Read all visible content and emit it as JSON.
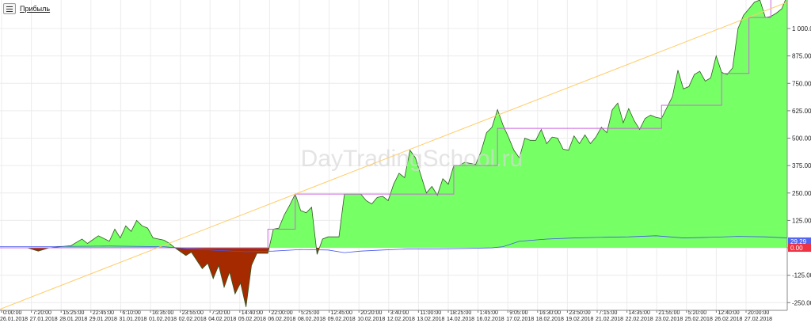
{
  "legend": {
    "label": "Прибыль"
  },
  "watermark": "DayTradingSchool.ru",
  "colors": {
    "profit": "#77ff66",
    "loss": "#a52a00",
    "line_purple": "#cc66dd",
    "line_blue": "#4455ee",
    "trend": "#ffcc66",
    "grid": "#ececec"
  },
  "chart_data": {
    "type": "area",
    "title": "",
    "y_ticks": [
      "1 000.00",
      "875.00",
      "750.00",
      "625.00",
      "500.00",
      "375.00",
      "250.00",
      "125.00",
      "0.00",
      "-125.00",
      "-250.00"
    ],
    "y_tick_values": [
      1000,
      875,
      750,
      625,
      500,
      375,
      250,
      125,
      0,
      -125,
      -250
    ],
    "ylim": [
      -285,
      1130
    ],
    "x_tick_times": [
      "0:00:00",
      "7:20:00",
      "15:25:00",
      "22:45:00",
      "6:10:00",
      "16:35:00",
      "23:55:00",
      "7:20:00",
      "14:40:00",
      "22:00:00",
      "5:25:00",
      "12:45:00",
      "20:20:00",
      "3:40:00",
      "11:00:00",
      "18:25:00",
      "1:45:00",
      "9:05:00",
      "16:30:00",
      "23:50:00",
      "7:15:00",
      "14:35:00",
      "21:55:00",
      "5:20:00",
      "12:40:00",
      "20:00:00"
    ],
    "x_tick_dates": [
      "26.01.2018",
      "27.01.2018",
      "28.01.2018",
      "29.01.2018",
      "31.01.2018",
      "01.02.2018",
      "02.02.2018",
      "04.02.2018",
      "05.02.2018",
      "06.02.2018",
      "08.02.2018",
      "09.02.2018",
      "10.02.2018",
      "12.02.2018",
      "13.02.2018",
      "14.02.2018",
      "16.02.2018",
      "17.02.2018",
      "18.02.2018",
      "19.02.2018",
      "21.02.2018",
      "22.02.2018",
      "23.02.2018",
      "25.02.2018",
      "26.02.2018",
      "27.02.2018"
    ],
    "value_labels": [
      {
        "text": "29.29",
        "value": 29.29,
        "color": "#5566ee"
      },
      {
        "text": "0.00",
        "value": 0,
        "color": "#ee3344"
      }
    ],
    "series": [
      {
        "name": "",
        "style": "area",
        "points": [
          [
            0,
            0
          ],
          [
            3,
            0
          ],
          [
            5,
            0
          ],
          [
            7,
            -15
          ],
          [
            9,
            0
          ],
          [
            13,
            10
          ],
          [
            15,
            40
          ],
          [
            16,
            20
          ],
          [
            18,
            55
          ],
          [
            20,
            30
          ],
          [
            21,
            85
          ],
          [
            22,
            45
          ],
          [
            23,
            100
          ],
          [
            24,
            75
          ],
          [
            25,
            125
          ],
          [
            26,
            100
          ],
          [
            27,
            90
          ],
          [
            28,
            45
          ],
          [
            30,
            35
          ],
          [
            31,
            20
          ],
          [
            32,
            0
          ],
          [
            34,
            -35
          ],
          [
            35,
            -20
          ],
          [
            37,
            -95
          ],
          [
            38,
            -70
          ],
          [
            39,
            -140
          ],
          [
            40,
            -80
          ],
          [
            41,
            -180
          ],
          [
            42,
            -110
          ],
          [
            43,
            -210
          ],
          [
            44,
            -160
          ],
          [
            45,
            -270
          ],
          [
            46,
            -80
          ],
          [
            47,
            -25
          ],
          [
            49,
            -25
          ],
          [
            50,
            85
          ],
          [
            51,
            90
          ],
          [
            52,
            150
          ],
          [
            53,
            195
          ],
          [
            54,
            245
          ],
          [
            55,
            170
          ],
          [
            56,
            160
          ],
          [
            57,
            185
          ],
          [
            58,
            -30
          ],
          [
            59,
            40
          ],
          [
            60,
            50
          ],
          [
            62,
            50
          ],
          [
            63,
            245
          ],
          [
            64,
            245
          ],
          [
            65,
            245
          ],
          [
            66,
            245
          ],
          [
            67,
            215
          ],
          [
            68,
            200
          ],
          [
            69,
            230
          ],
          [
            70,
            235
          ],
          [
            71,
            215
          ],
          [
            72,
            290
          ],
          [
            73,
            340
          ],
          [
            74,
            320
          ],
          [
            75,
            445
          ],
          [
            76,
            410
          ],
          [
            77,
            330
          ],
          [
            78,
            250
          ],
          [
            79,
            280
          ],
          [
            80,
            240
          ],
          [
            81,
            315
          ],
          [
            82,
            290
          ],
          [
            83,
            375
          ],
          [
            84,
            375
          ],
          [
            85,
            390
          ],
          [
            86,
            385
          ],
          [
            87,
            380
          ],
          [
            88,
            440
          ],
          [
            89,
            525
          ],
          [
            90,
            550
          ],
          [
            91,
            630
          ],
          [
            92,
            560
          ],
          [
            93,
            505
          ],
          [
            94,
            445
          ],
          [
            95,
            410
          ],
          [
            96,
            500
          ],
          [
            97,
            490
          ],
          [
            98,
            490
          ],
          [
            99,
            540
          ],
          [
            100,
            475
          ],
          [
            101,
            505
          ],
          [
            102,
            500
          ],
          [
            103,
            450
          ],
          [
            104,
            445
          ],
          [
            105,
            510
          ],
          [
            106,
            475
          ],
          [
            107,
            515
          ],
          [
            108,
            475
          ],
          [
            109,
            505
          ],
          [
            110,
            550
          ],
          [
            111,
            525
          ],
          [
            112,
            630
          ],
          [
            113,
            660
          ],
          [
            114,
            570
          ],
          [
            115,
            635
          ],
          [
            116,
            580
          ],
          [
            117,
            540
          ],
          [
            118,
            590
          ],
          [
            119,
            605
          ],
          [
            120,
            595
          ],
          [
            121,
            590
          ],
          [
            122,
            640
          ],
          [
            123,
            690
          ],
          [
            124,
            810
          ],
          [
            125,
            725
          ],
          [
            126,
            735
          ],
          [
            127,
            790
          ],
          [
            128,
            805
          ],
          [
            129,
            760
          ],
          [
            130,
            775
          ],
          [
            131,
            875
          ],
          [
            132,
            800
          ],
          [
            133,
            790
          ],
          [
            134,
            820
          ],
          [
            135,
            1000
          ],
          [
            136,
            1060
          ],
          [
            137,
            1090
          ],
          [
            138,
            1120
          ],
          [
            139,
            1130
          ],
          [
            140,
            1050
          ],
          [
            141,
            1055
          ],
          [
            142,
            1070
          ],
          [
            143,
            1090
          ],
          [
            144,
            1150
          ]
        ]
      },
      {
        "name": "",
        "style": "step",
        "points": [
          [
            0,
            0
          ],
          [
            49,
            0
          ],
          [
            49,
            85
          ],
          [
            54,
            85
          ],
          [
            54,
            245
          ],
          [
            63,
            245
          ],
          [
            63,
            245
          ],
          [
            83,
            245
          ],
          [
            83,
            375
          ],
          [
            91,
            375
          ],
          [
            91,
            545
          ],
          [
            102,
            545
          ],
          [
            102,
            545
          ],
          [
            121,
            545
          ],
          [
            121,
            650
          ],
          [
            132,
            650
          ],
          [
            132,
            795
          ],
          [
            137,
            795
          ],
          [
            137,
            1050
          ],
          [
            141,
            1050
          ],
          [
            141,
            1140
          ],
          [
            143,
            1140
          ]
        ]
      },
      {
        "name": "",
        "style": "line",
        "points": [
          [
            0,
            5
          ],
          [
            10,
            6
          ],
          [
            20,
            8
          ],
          [
            30,
            5
          ],
          [
            35,
            -5
          ],
          [
            40,
            -12
          ],
          [
            45,
            -18
          ],
          [
            50,
            -15
          ],
          [
            55,
            -8
          ],
          [
            60,
            -10
          ],
          [
            63,
            -22
          ],
          [
            66,
            -15
          ],
          [
            70,
            -10
          ],
          [
            75,
            -5
          ],
          [
            80,
            -5
          ],
          [
            85,
            -3
          ],
          [
            90,
            0
          ],
          [
            92,
            5
          ],
          [
            95,
            30
          ],
          [
            100,
            40
          ],
          [
            105,
            45
          ],
          [
            110,
            48
          ],
          [
            115,
            50
          ],
          [
            120,
            55
          ],
          [
            125,
            45
          ],
          [
            130,
            48
          ],
          [
            135,
            52
          ],
          [
            140,
            50
          ],
          [
            144,
            45
          ]
        ]
      },
      {
        "name": "",
        "style": "line",
        "points": [
          [
            0,
            -280
          ],
          [
            144,
            1120
          ]
        ]
      }
    ]
  }
}
